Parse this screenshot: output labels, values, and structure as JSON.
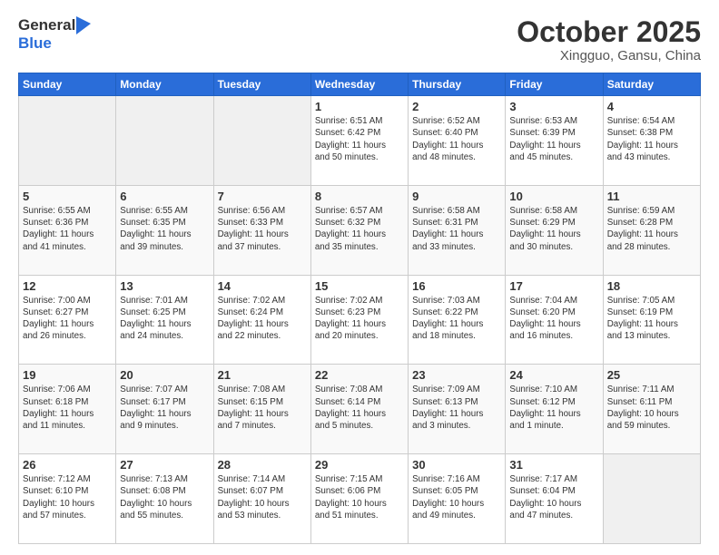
{
  "header": {
    "logo_line1": "General",
    "logo_line2": "Blue",
    "title": "October 2025",
    "subtitle": "Xingguo, Gansu, China"
  },
  "days_of_week": [
    "Sunday",
    "Monday",
    "Tuesday",
    "Wednesday",
    "Thursday",
    "Friday",
    "Saturday"
  ],
  "weeks": [
    [
      {
        "day": "",
        "info": ""
      },
      {
        "day": "",
        "info": ""
      },
      {
        "day": "",
        "info": ""
      },
      {
        "day": "1",
        "info": "Sunrise: 6:51 AM\nSunset: 6:42 PM\nDaylight: 11 hours\nand 50 minutes."
      },
      {
        "day": "2",
        "info": "Sunrise: 6:52 AM\nSunset: 6:40 PM\nDaylight: 11 hours\nand 48 minutes."
      },
      {
        "day": "3",
        "info": "Sunrise: 6:53 AM\nSunset: 6:39 PM\nDaylight: 11 hours\nand 45 minutes."
      },
      {
        "day": "4",
        "info": "Sunrise: 6:54 AM\nSunset: 6:38 PM\nDaylight: 11 hours\nand 43 minutes."
      }
    ],
    [
      {
        "day": "5",
        "info": "Sunrise: 6:55 AM\nSunset: 6:36 PM\nDaylight: 11 hours\nand 41 minutes."
      },
      {
        "day": "6",
        "info": "Sunrise: 6:55 AM\nSunset: 6:35 PM\nDaylight: 11 hours\nand 39 minutes."
      },
      {
        "day": "7",
        "info": "Sunrise: 6:56 AM\nSunset: 6:33 PM\nDaylight: 11 hours\nand 37 minutes."
      },
      {
        "day": "8",
        "info": "Sunrise: 6:57 AM\nSunset: 6:32 PM\nDaylight: 11 hours\nand 35 minutes."
      },
      {
        "day": "9",
        "info": "Sunrise: 6:58 AM\nSunset: 6:31 PM\nDaylight: 11 hours\nand 33 minutes."
      },
      {
        "day": "10",
        "info": "Sunrise: 6:58 AM\nSunset: 6:29 PM\nDaylight: 11 hours\nand 30 minutes."
      },
      {
        "day": "11",
        "info": "Sunrise: 6:59 AM\nSunset: 6:28 PM\nDaylight: 11 hours\nand 28 minutes."
      }
    ],
    [
      {
        "day": "12",
        "info": "Sunrise: 7:00 AM\nSunset: 6:27 PM\nDaylight: 11 hours\nand 26 minutes."
      },
      {
        "day": "13",
        "info": "Sunrise: 7:01 AM\nSunset: 6:25 PM\nDaylight: 11 hours\nand 24 minutes."
      },
      {
        "day": "14",
        "info": "Sunrise: 7:02 AM\nSunset: 6:24 PM\nDaylight: 11 hours\nand 22 minutes."
      },
      {
        "day": "15",
        "info": "Sunrise: 7:02 AM\nSunset: 6:23 PM\nDaylight: 11 hours\nand 20 minutes."
      },
      {
        "day": "16",
        "info": "Sunrise: 7:03 AM\nSunset: 6:22 PM\nDaylight: 11 hours\nand 18 minutes."
      },
      {
        "day": "17",
        "info": "Sunrise: 7:04 AM\nSunset: 6:20 PM\nDaylight: 11 hours\nand 16 minutes."
      },
      {
        "day": "18",
        "info": "Sunrise: 7:05 AM\nSunset: 6:19 PM\nDaylight: 11 hours\nand 13 minutes."
      }
    ],
    [
      {
        "day": "19",
        "info": "Sunrise: 7:06 AM\nSunset: 6:18 PM\nDaylight: 11 hours\nand 11 minutes."
      },
      {
        "day": "20",
        "info": "Sunrise: 7:07 AM\nSunset: 6:17 PM\nDaylight: 11 hours\nand 9 minutes."
      },
      {
        "day": "21",
        "info": "Sunrise: 7:08 AM\nSunset: 6:15 PM\nDaylight: 11 hours\nand 7 minutes."
      },
      {
        "day": "22",
        "info": "Sunrise: 7:08 AM\nSunset: 6:14 PM\nDaylight: 11 hours\nand 5 minutes."
      },
      {
        "day": "23",
        "info": "Sunrise: 7:09 AM\nSunset: 6:13 PM\nDaylight: 11 hours\nand 3 minutes."
      },
      {
        "day": "24",
        "info": "Sunrise: 7:10 AM\nSunset: 6:12 PM\nDaylight: 11 hours\nand 1 minute."
      },
      {
        "day": "25",
        "info": "Sunrise: 7:11 AM\nSunset: 6:11 PM\nDaylight: 10 hours\nand 59 minutes."
      }
    ],
    [
      {
        "day": "26",
        "info": "Sunrise: 7:12 AM\nSunset: 6:10 PM\nDaylight: 10 hours\nand 57 minutes."
      },
      {
        "day": "27",
        "info": "Sunrise: 7:13 AM\nSunset: 6:08 PM\nDaylight: 10 hours\nand 55 minutes."
      },
      {
        "day": "28",
        "info": "Sunrise: 7:14 AM\nSunset: 6:07 PM\nDaylight: 10 hours\nand 53 minutes."
      },
      {
        "day": "29",
        "info": "Sunrise: 7:15 AM\nSunset: 6:06 PM\nDaylight: 10 hours\nand 51 minutes."
      },
      {
        "day": "30",
        "info": "Sunrise: 7:16 AM\nSunset: 6:05 PM\nDaylight: 10 hours\nand 49 minutes."
      },
      {
        "day": "31",
        "info": "Sunrise: 7:17 AM\nSunset: 6:04 PM\nDaylight: 10 hours\nand 47 minutes."
      },
      {
        "day": "",
        "info": ""
      }
    ]
  ]
}
